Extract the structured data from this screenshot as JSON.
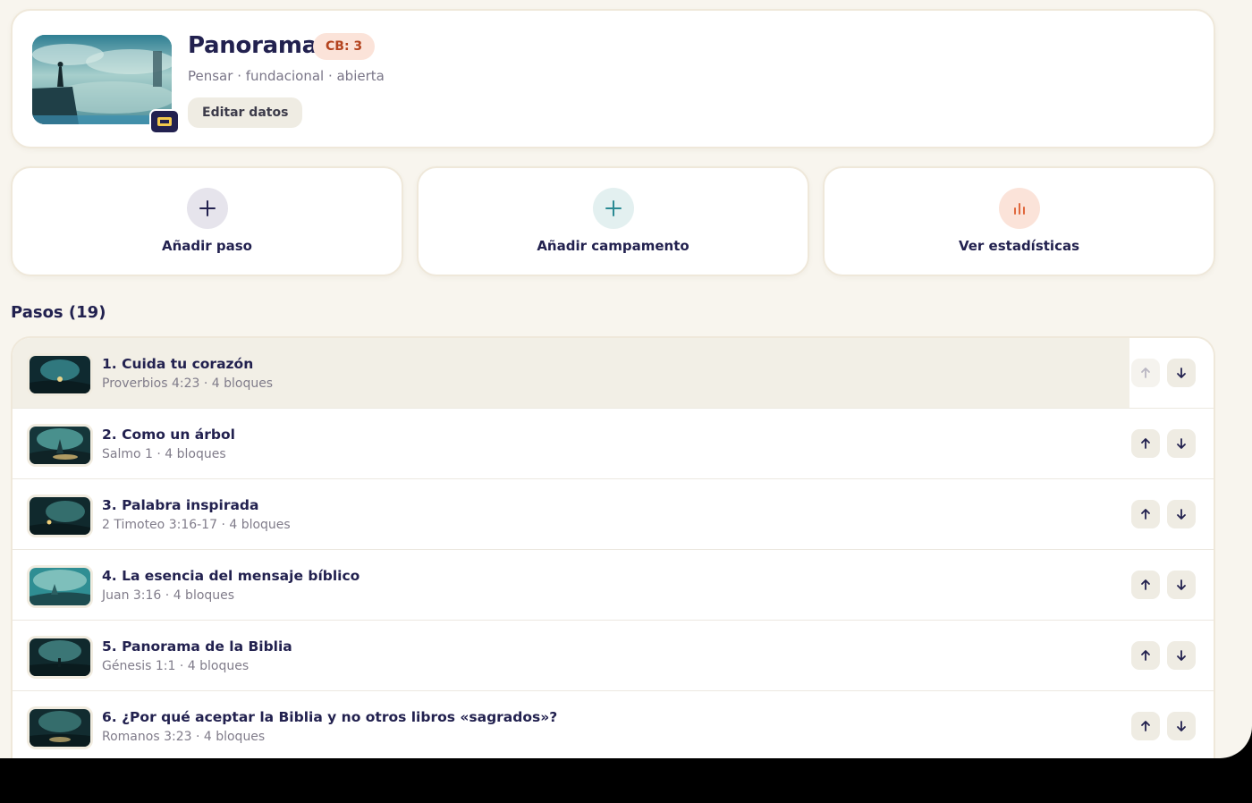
{
  "header": {
    "title": "Panorama",
    "badge": "CB: 3",
    "subtitle": "Pensar · fundacional · abierta",
    "edit_label": "Editar datos"
  },
  "actions": [
    {
      "label": "Añadir paso",
      "icon": "plus-icon",
      "color": "#22214f",
      "bg": "#e6e4ec"
    },
    {
      "label": "Añadir campamento",
      "icon": "plus-icon",
      "color": "#2a8a93",
      "bg": "#e3f0f0"
    },
    {
      "label": "Ver estadísticas",
      "icon": "bar-chart-icon",
      "color": "#e0683d",
      "bg": "#fbe3d9"
    }
  ],
  "steps_section": {
    "title": "Pasos (19)",
    "items": [
      {
        "title": "1. Cuida tu corazón",
        "subtitle": "Proverbios 4:23 · 4 bloques"
      },
      {
        "title": "2. Como un árbol",
        "subtitle": "Salmo 1 · 4 bloques"
      },
      {
        "title": "3. Palabra inspirada",
        "subtitle": "2 Timoteo 3:16-17 · 4 bloques"
      },
      {
        "title": "4. La esencia del mensaje bíblico",
        "subtitle": "Juan 3:16 · 4 bloques"
      },
      {
        "title": "5. Panorama de la Biblia",
        "subtitle": "Génesis 1:1 · 4 bloques"
      },
      {
        "title": "6. ¿Por qué aceptar la Biblia y no otros libros «sagrados»?",
        "subtitle": "Romanos 3:23 · 4 bloques"
      }
    ]
  },
  "colors": {
    "background": "#f8f5ee",
    "primary": "#22214f",
    "badge_bg": "#fbe3d9",
    "badge_text": "#b4441f",
    "teal": "#2a8a93",
    "orange": "#e0683d"
  }
}
